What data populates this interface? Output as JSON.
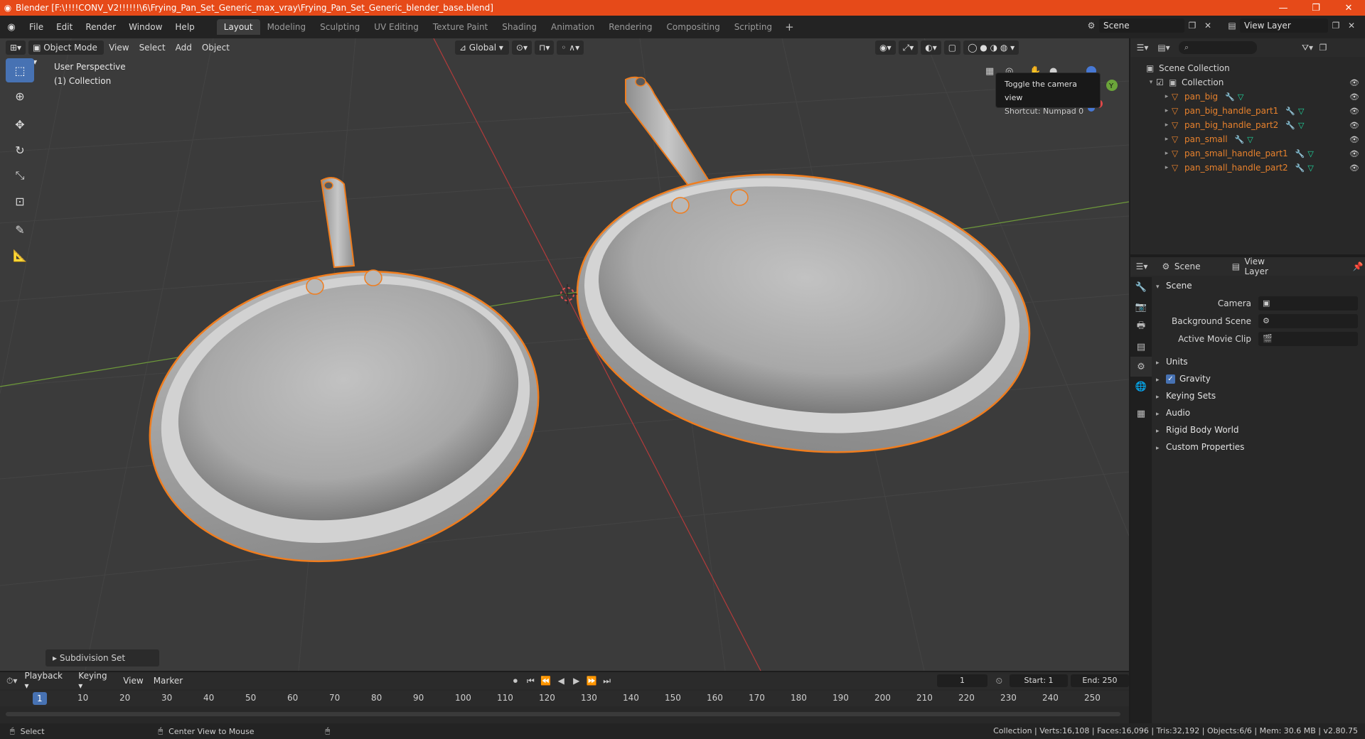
{
  "window": {
    "title": "Blender [F:\\!!!!CONV_V2!!!!!!\\6\\Frying_Pan_Set_Generic_max_vray\\Frying_Pan_Set_Generic_blender_base.blend]",
    "minimize": "—",
    "restore": "❐",
    "close": "✕"
  },
  "menu": [
    "File",
    "Edit",
    "Render",
    "Window",
    "Help"
  ],
  "workspaces": [
    "Layout",
    "Modeling",
    "Sculpting",
    "UV Editing",
    "Texture Paint",
    "Shading",
    "Animation",
    "Rendering",
    "Compositing",
    "Scripting"
  ],
  "active_workspace": "Layout",
  "scene_name": "Scene",
  "view_layer_name": "View Layer",
  "viewport": {
    "mode": "Object Mode",
    "menus": [
      "View",
      "Select",
      "Add",
      "Object"
    ],
    "transform_orientation": "Global",
    "perspective_label": "User Perspective",
    "collection_label": "(1) Collection",
    "tooltip_title": "Toggle the camera view",
    "tooltip_shortcut": "Shortcut: Numpad 0",
    "last_operator": "Subdivision Set"
  },
  "outliner": {
    "root": "Scene Collection",
    "collection": "Collection",
    "objects": [
      {
        "name": "pan_big"
      },
      {
        "name": "pan_big_handle_part1"
      },
      {
        "name": "pan_big_handle_part2"
      },
      {
        "name": "pan_small"
      },
      {
        "name": "pan_small_handle_part1"
      },
      {
        "name": "pan_small_handle_part2"
      }
    ]
  },
  "properties": {
    "scene_tab": "Scene",
    "view_layer_tab": "View Layer",
    "panel": "Scene",
    "camera_label": "Camera",
    "background_label": "Background Scene",
    "movie_clip_label": "Active Movie Clip",
    "collapsed_panels": [
      "Units",
      "Gravity",
      "Keying Sets",
      "Audio",
      "Rigid Body World",
      "Custom Properties"
    ]
  },
  "timeline": {
    "menus": [
      "Playback",
      "Keying",
      "View",
      "Marker"
    ],
    "current_frame": "1",
    "start_label": "Start:",
    "start": "1",
    "end_label": "End:",
    "end": "250",
    "ruler": [
      "10",
      "20",
      "30",
      "40",
      "50",
      "60",
      "70",
      "80",
      "90",
      "100",
      "110",
      "120",
      "130",
      "140",
      "150",
      "160",
      "170",
      "180",
      "190",
      "200",
      "210",
      "220",
      "230",
      "240",
      "250"
    ]
  },
  "status": {
    "select": "Select",
    "center_view": "Center View to Mouse",
    "stats": "Collection | Verts:16,108 | Faces:16,096 | Tris:32,192 | Objects:6/6 | Mem: 30.6 MB | v2.80.75"
  },
  "colors": {
    "title_bar": "#e64a19",
    "selection_outline": "#f07d1e",
    "accent": "#4772b3"
  }
}
